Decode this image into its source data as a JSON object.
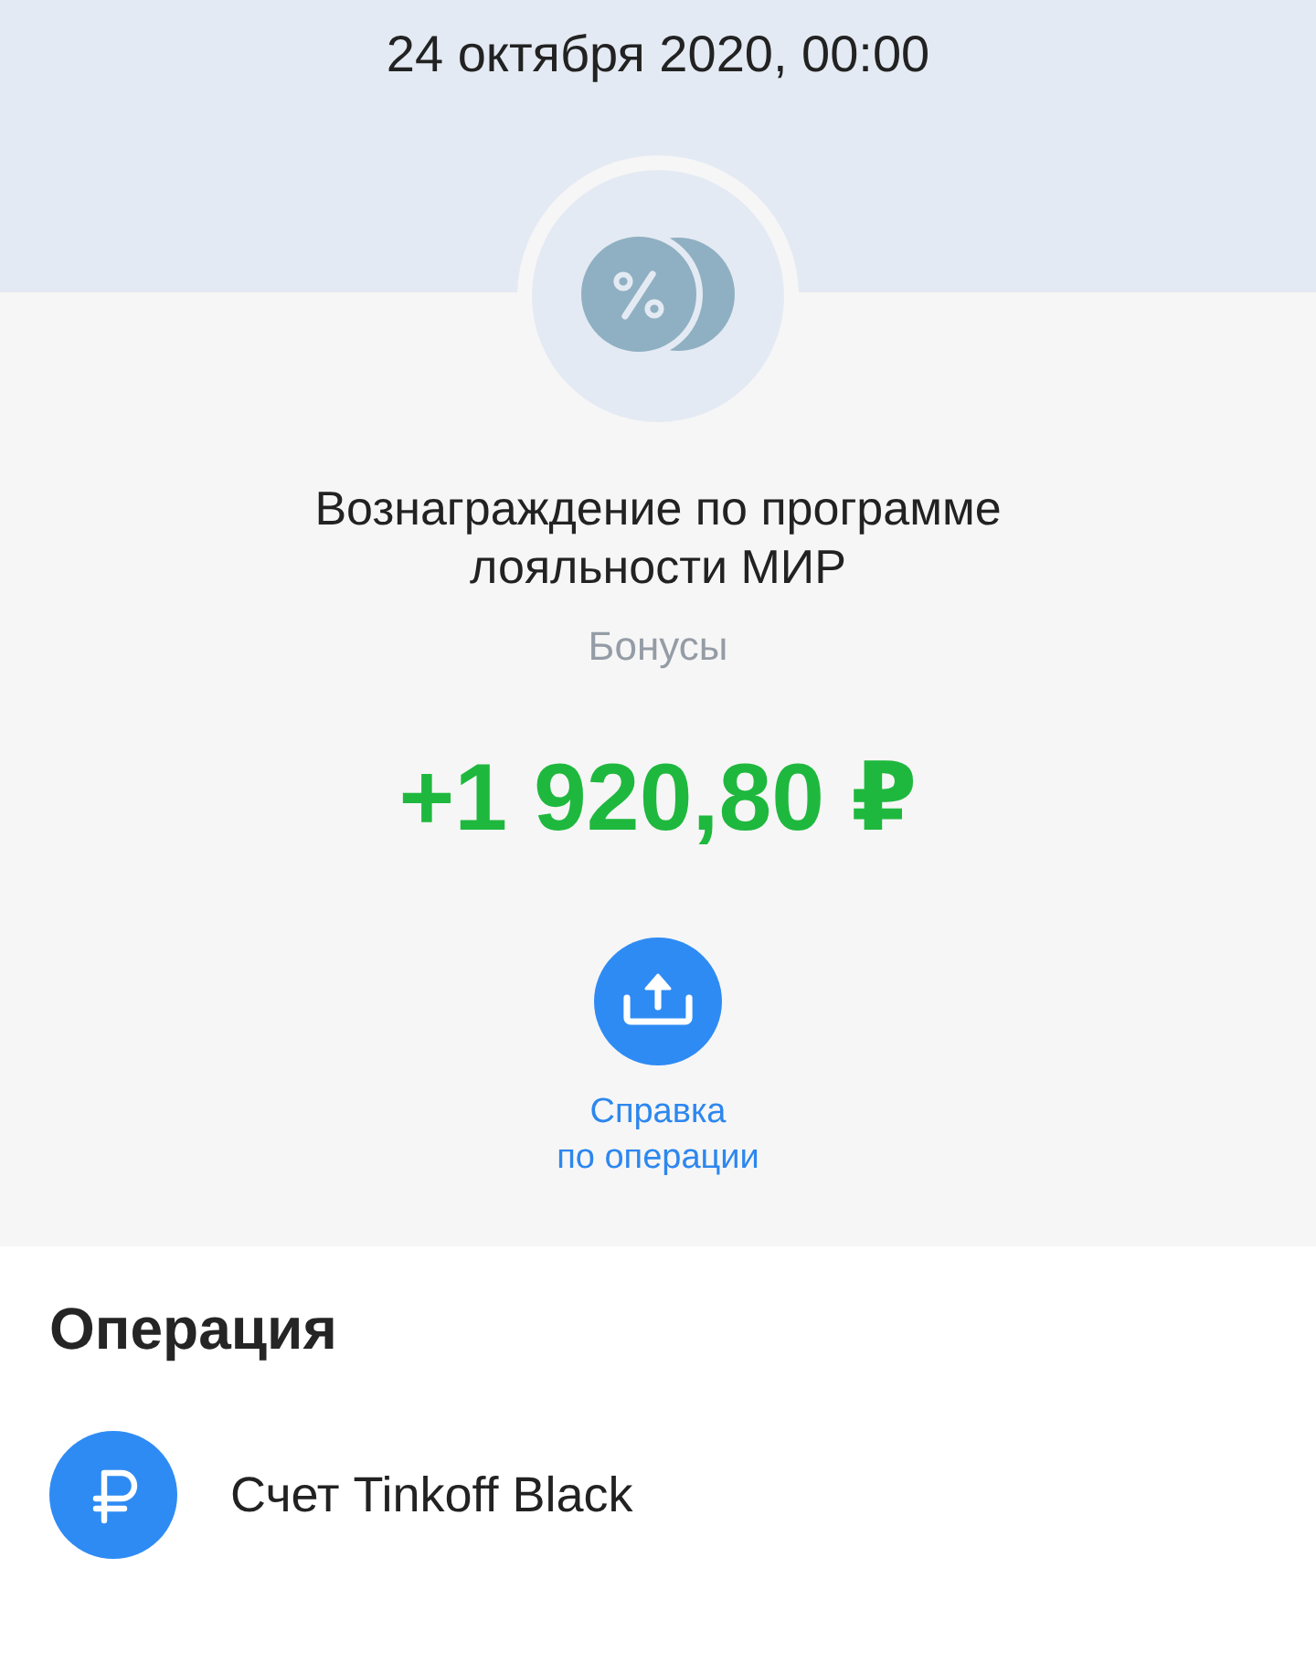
{
  "header": {
    "date": "24 октября 2020, 00:00"
  },
  "transaction": {
    "title": "Вознаграждение по программе лояльности МИР",
    "category": "Бонусы",
    "amount": "+1 920,80 ₽"
  },
  "actions": [
    {
      "label": "Справка\nпо операции"
    }
  ],
  "operation": {
    "title": "Операция",
    "account": {
      "name": "Счет Tinkoff Black"
    }
  }
}
